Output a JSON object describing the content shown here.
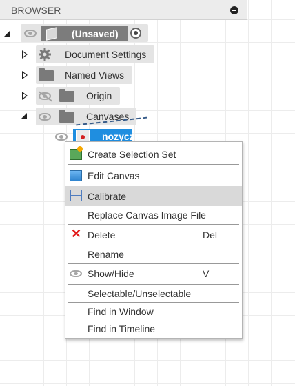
{
  "browser": {
    "title": "BROWSER"
  },
  "tree": {
    "root_label": "(Unsaved)",
    "items": [
      {
        "label": "Document Settings"
      },
      {
        "label": "Named Views"
      },
      {
        "label": "Origin"
      },
      {
        "label": "Canvases"
      }
    ],
    "canvas_item_label": "nozyczki"
  },
  "context_menu": {
    "items": [
      {
        "label": "Create Selection Set",
        "icon": "selection-set-icon"
      },
      {
        "label": "Edit Canvas",
        "icon": "edit-canvas-icon"
      },
      {
        "label": "Calibrate",
        "icon": "calibrate-icon",
        "highlighted": true
      },
      {
        "label": "Replace Canvas Image File"
      },
      {
        "label": "Delete",
        "icon": "delete-icon",
        "shortcut": "Del"
      },
      {
        "label": "Rename"
      },
      {
        "label": "Show/Hide",
        "icon": "eye-icon",
        "shortcut": "V"
      },
      {
        "label": "Selectable/Unselectable"
      },
      {
        "label": "Find in Window"
      },
      {
        "label": "Find in Timeline"
      }
    ]
  },
  "colors": {
    "selection_blue": "#1f8ee0",
    "highlight": "#d9d9d9",
    "delete_red": "#e21c1c"
  }
}
